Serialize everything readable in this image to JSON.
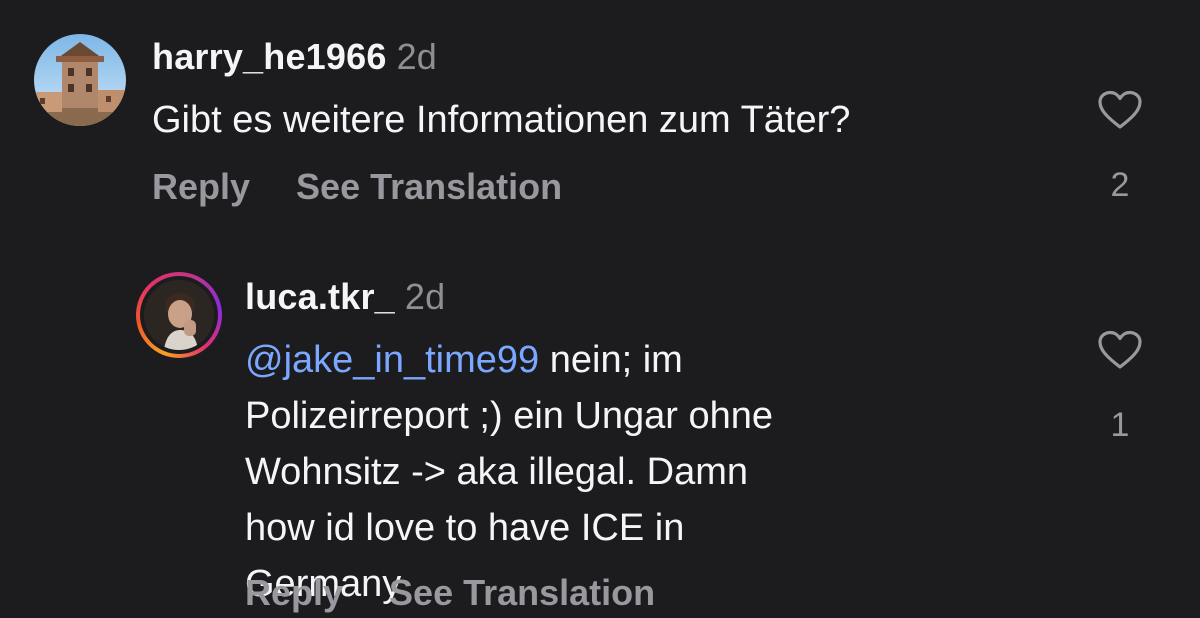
{
  "comments": [
    {
      "username": "harry_he1966",
      "time": "2d",
      "text": "Gibt es weitere Informationen zum Täter?",
      "reply_label": "Reply",
      "translate_label": "See Translation",
      "like_count": "2"
    },
    {
      "username": "luca.tkr_",
      "time": "2d",
      "mention": "@jake_in_time99",
      "text": " nein; im Polizeirreport ;) ein Ungar ohne Wohnsitz -> aka illegal. Damn how id love to have ICE in Germany",
      "reply_label": "Reply",
      "translate_label": "See Translation",
      "like_count": "1"
    }
  ],
  "icons": {
    "like": "heart-outline-icon"
  },
  "colors": {
    "background": "#1c1c1e",
    "mention": "#7aa7ff",
    "muted": "#98989f",
    "story_ring": [
      "#f9a020",
      "#e1306c",
      "#8a2be2"
    ]
  }
}
